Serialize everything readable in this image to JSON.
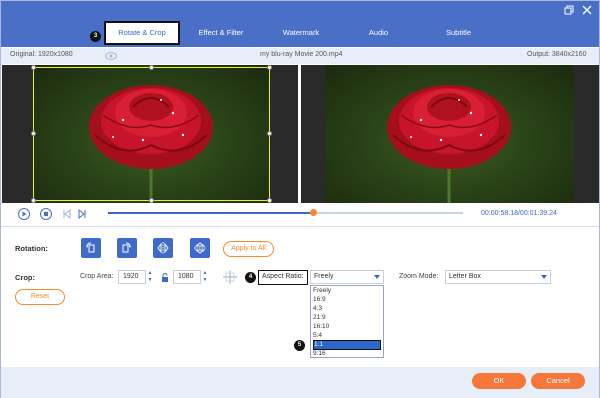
{
  "tabs": [
    {
      "label": "Rotate & Crop",
      "active": true
    },
    {
      "label": "Effect & Filter",
      "active": false
    },
    {
      "label": "Watermark",
      "active": false
    },
    {
      "label": "Audio",
      "active": false
    },
    {
      "label": "Subtitle",
      "active": false
    }
  ],
  "window": {
    "restore_icon": "restore-icon",
    "close_icon": "close-icon"
  },
  "badges": {
    "tabs": "3",
    "aspect": "4",
    "option": "5"
  },
  "info": {
    "original": "Original: 1920x1080",
    "filename": "my blu-ray Movie 200.mp4",
    "output": "Output: 3840x2160"
  },
  "player": {
    "timecode": "00:00:58.18/00:01:39.24",
    "progress": 0.58
  },
  "rotation": {
    "label": "Rotation:",
    "apply_all": "Apply to All"
  },
  "crop": {
    "label": "Crop:",
    "area_label": "Crop Area:",
    "width": "1920",
    "height": "1080",
    "aspect_label": "Aspect Ratio:",
    "aspect_value": "Freely",
    "zoom_label": "Zoom Mode:",
    "zoom_value": "Letter Box",
    "reset": "Reset"
  },
  "aspect_options": [
    "Freely",
    "16:9",
    "4:3",
    "21:9",
    "16:10",
    "5:4",
    "1:1",
    "9:16"
  ],
  "aspect_selected": "1:1",
  "footer": {
    "ok": "OK",
    "cancel": "Cancel"
  },
  "colors": {
    "accent": "#4a6fc7",
    "orange": "#f5773a",
    "crop_frame": "#e9f22d"
  }
}
